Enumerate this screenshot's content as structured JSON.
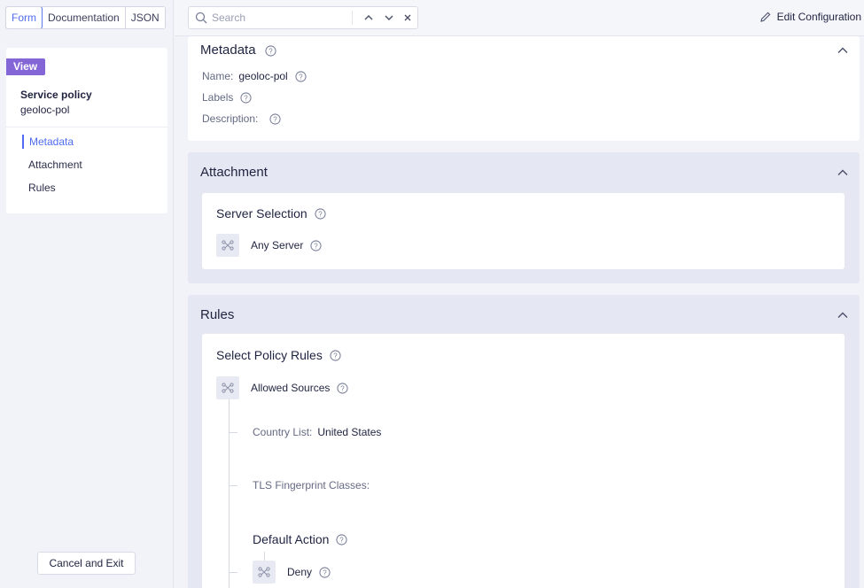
{
  "view_toggle": {
    "form": "Form",
    "documentation": "Documentation",
    "json": "JSON"
  },
  "nav": {
    "badge": "View",
    "object_type": "Service policy",
    "object_name": "geoloc-pol",
    "items": [
      {
        "label": "Metadata"
      },
      {
        "label": "Attachment"
      },
      {
        "label": "Rules"
      }
    ]
  },
  "cancel_label": "Cancel and Exit",
  "search": {
    "placeholder": "Search"
  },
  "edit_config_label": "Edit Configuration",
  "metadata": {
    "title": "Metadata",
    "name_label": "Name:",
    "name_value": "geoloc-pol",
    "labels_label": "Labels",
    "description_label": "Description:"
  },
  "attachment": {
    "title": "Attachment",
    "server_selection_title": "Server Selection",
    "any_server_label": "Any Server"
  },
  "rules": {
    "title": "Rules",
    "select_title": "Select Policy Rules",
    "allowed_sources_label": "Allowed Sources",
    "country_list_label": "Country List:",
    "country_list_value": "United States",
    "tls_label": "TLS Fingerprint Classes:",
    "default_action_title": "Default Action",
    "deny_label": "Deny"
  },
  "colors": {
    "accent": "#4f6cf0",
    "badge": "#8466d6",
    "section_bg": "#e5e7f2"
  }
}
